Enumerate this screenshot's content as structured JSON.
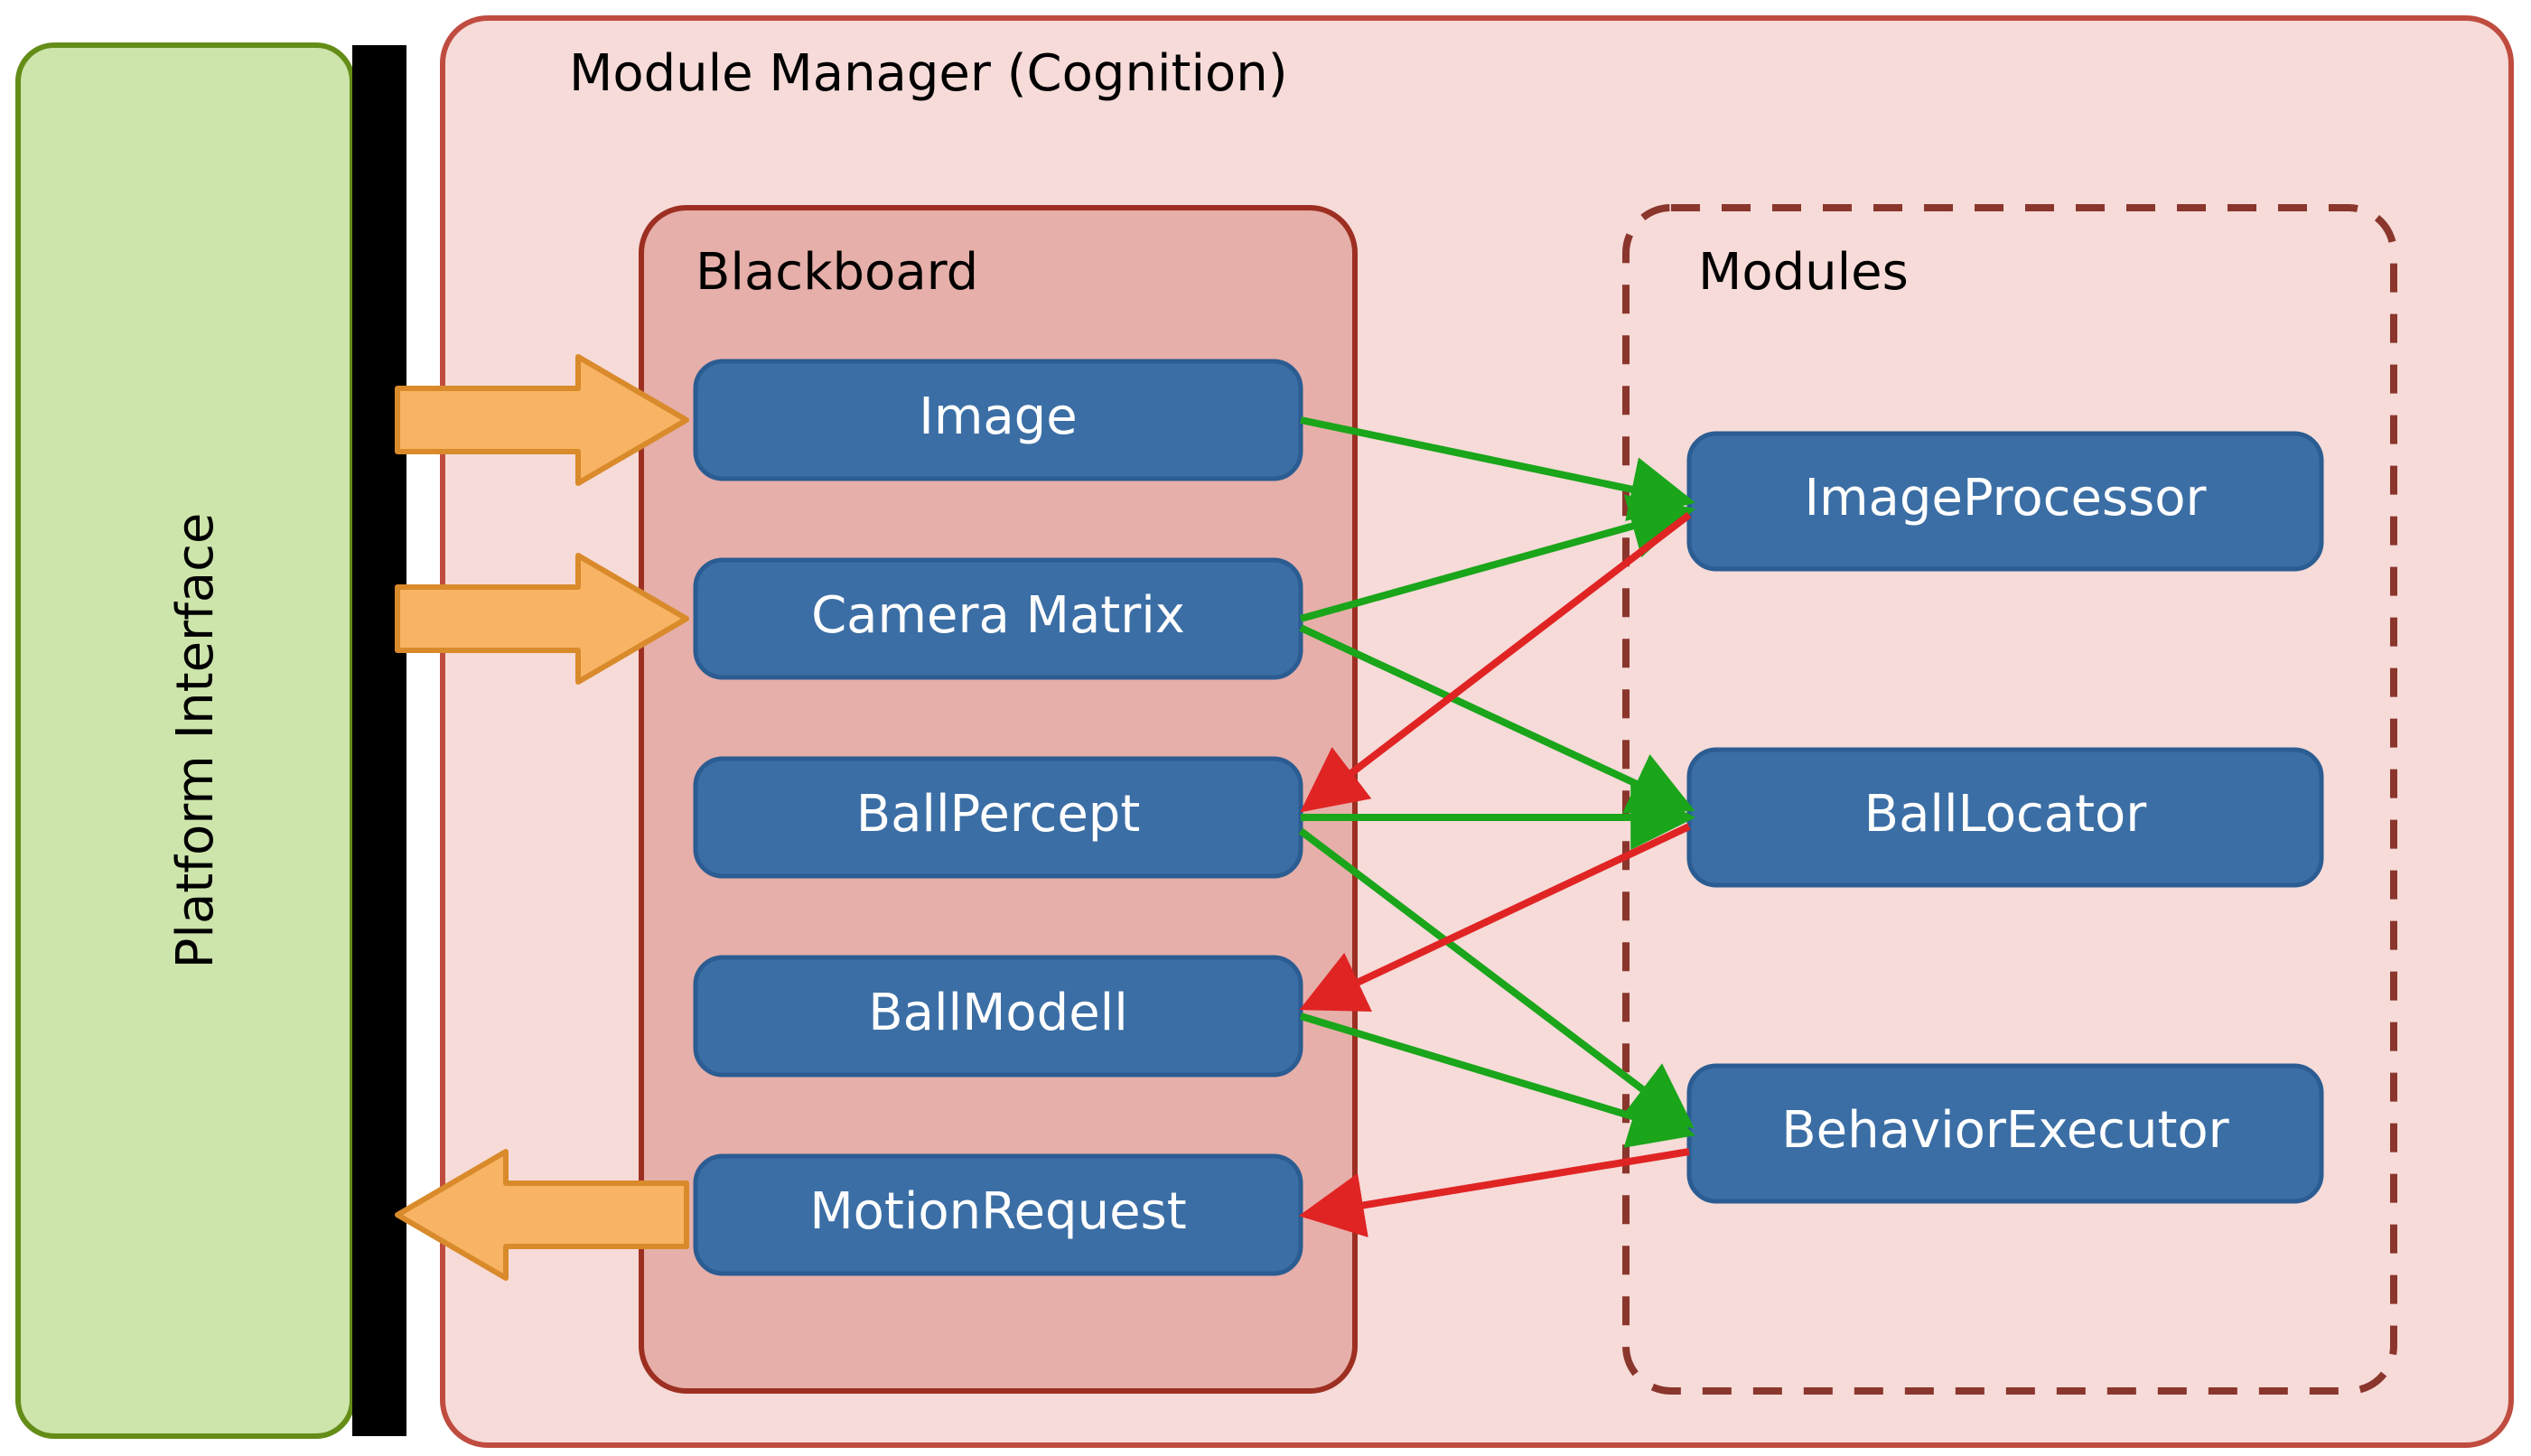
{
  "platform_interface": {
    "label": "Platform Interface"
  },
  "module_manager": {
    "label": "Module Manager (Cognition)"
  },
  "blackboard": {
    "label": "Blackboard",
    "items": [
      {
        "label": "Image"
      },
      {
        "label": "Camera Matrix"
      },
      {
        "label": "BallPercept"
      },
      {
        "label": "BallModell"
      },
      {
        "label": "MotionRequest"
      }
    ]
  },
  "modules": {
    "label": "Modules",
    "items": [
      {
        "label": "ImageProcessor"
      },
      {
        "label": "BallLocator"
      },
      {
        "label": "BehaviorExecutor"
      }
    ]
  },
  "flows": [
    {
      "kind": "block-arrow",
      "dir": "right",
      "from": "platform",
      "to": "blackboard.items.0"
    },
    {
      "kind": "block-arrow",
      "dir": "right",
      "from": "platform",
      "to": "blackboard.items.1"
    },
    {
      "kind": "block-arrow",
      "dir": "left",
      "from": "platform",
      "to": "blackboard.items.4"
    },
    {
      "kind": "green",
      "from": "blackboard.items.0",
      "to": "modules.items.0"
    },
    {
      "kind": "green",
      "from": "blackboard.items.1",
      "to": "modules.items.0"
    },
    {
      "kind": "green",
      "from": "blackboard.items.1",
      "to": "modules.items.1"
    },
    {
      "kind": "green",
      "from": "blackboard.items.2",
      "to": "modules.items.1"
    },
    {
      "kind": "green",
      "from": "blackboard.items.2",
      "to": "modules.items.2"
    },
    {
      "kind": "green",
      "from": "blackboard.items.3",
      "to": "modules.items.2"
    },
    {
      "kind": "red",
      "from": "modules.items.0",
      "to": "blackboard.items.2"
    },
    {
      "kind": "red",
      "from": "modules.items.1",
      "to": "blackboard.items.3"
    },
    {
      "kind": "red",
      "from": "modules.items.2",
      "to": "blackboard.items.4"
    }
  ],
  "colors": {
    "platform_fill": "#cde4ab",
    "platform_stroke": "#648d18",
    "manager_fill": "#f6dbd8",
    "manager_stroke": "#bf4c3f",
    "blackboard_fill": "#e6afa9",
    "blackboard_stroke": "#9d2f22",
    "modules_stroke": "#8a362c",
    "blue_fill": "#3b6ea5",
    "blue_stroke": "#2b5c92",
    "arrow_fill": "#f8b464",
    "arrow_stroke": "#d98a2b",
    "green": "#1aa51a",
    "red": "#e02424"
  }
}
